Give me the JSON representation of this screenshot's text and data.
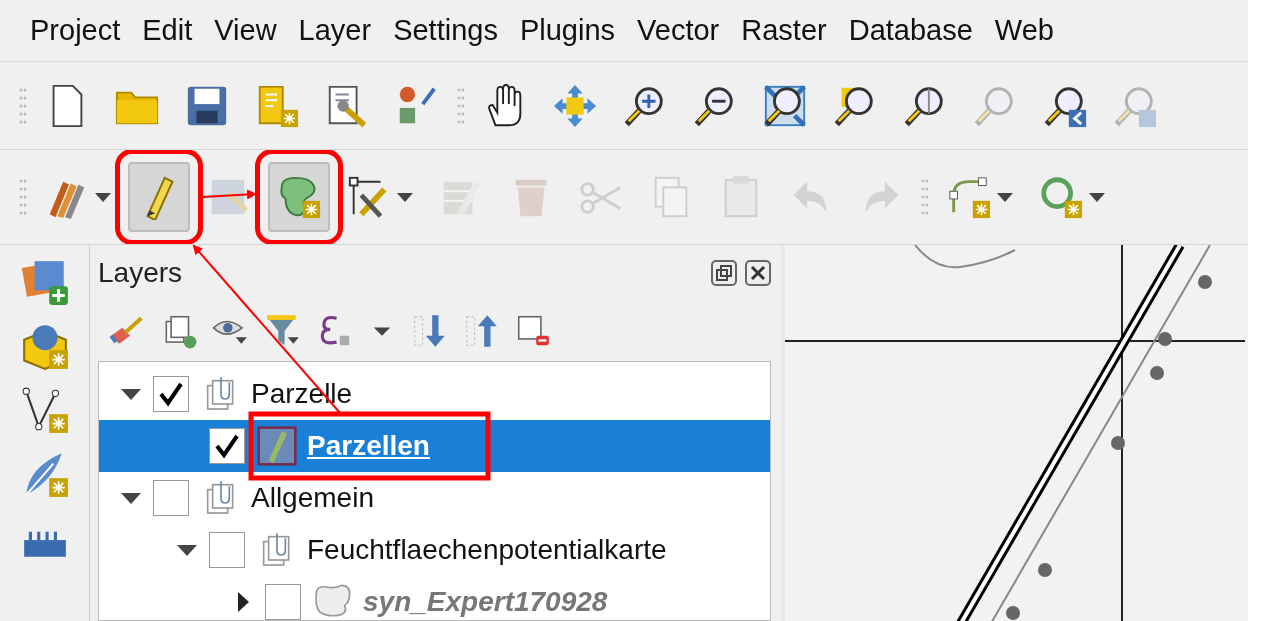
{
  "menu_bar": [
    {
      "label": "Project"
    },
    {
      "label": "Edit"
    },
    {
      "label": "View"
    },
    {
      "label": "Layer"
    },
    {
      "label": "Settings"
    },
    {
      "label": "Plugins"
    },
    {
      "label": "Vector"
    },
    {
      "label": "Raster"
    },
    {
      "label": "Database"
    },
    {
      "label": "Web"
    }
  ],
  "toolbar_1": [
    {
      "kind": "grip",
      "disabled": false,
      "pressed": false,
      "dropdown": false,
      "annotated": false
    },
    {
      "kind": "new-page",
      "disabled": false,
      "pressed": false,
      "dropdown": false,
      "annotated": false
    },
    {
      "kind": "folder",
      "disabled": false,
      "pressed": false,
      "dropdown": false,
      "annotated": false
    },
    {
      "kind": "floppy",
      "disabled": false,
      "pressed": false,
      "dropdown": false,
      "annotated": false
    },
    {
      "kind": "layout-doc",
      "disabled": false,
      "pressed": false,
      "dropdown": false,
      "annotated": false
    },
    {
      "kind": "wrench-doc",
      "disabled": false,
      "pressed": false,
      "dropdown": false,
      "annotated": false
    },
    {
      "kind": "shapes",
      "disabled": false,
      "pressed": false,
      "dropdown": false,
      "annotated": false
    },
    {
      "kind": "grip",
      "disabled": false,
      "pressed": false,
      "dropdown": false,
      "annotated": false
    },
    {
      "kind": "hand",
      "disabled": false,
      "pressed": false,
      "dropdown": false,
      "annotated": false
    },
    {
      "kind": "move-arrows",
      "disabled": false,
      "pressed": false,
      "dropdown": false,
      "annotated": false
    },
    {
      "kind": "zoom-in",
      "disabled": false,
      "pressed": false,
      "dropdown": false,
      "annotated": false
    },
    {
      "kind": "zoom-out",
      "disabled": false,
      "pressed": false,
      "dropdown": false,
      "annotated": false
    },
    {
      "kind": "zoom-full",
      "disabled": false,
      "pressed": false,
      "dropdown": false,
      "annotated": false
    },
    {
      "kind": "zoom-selection",
      "disabled": false,
      "pressed": false,
      "dropdown": false,
      "annotated": false
    },
    {
      "kind": "zoom-layer",
      "disabled": false,
      "pressed": false,
      "dropdown": false,
      "annotated": false
    },
    {
      "kind": "zoom-native",
      "disabled": true,
      "pressed": false,
      "dropdown": false,
      "annotated": false
    },
    {
      "kind": "zoom-last",
      "disabled": false,
      "pressed": false,
      "dropdown": false,
      "annotated": false
    },
    {
      "kind": "zoom-next",
      "disabled": true,
      "pressed": false,
      "dropdown": false,
      "annotated": false
    }
  ],
  "toolbar_2": [
    {
      "kind": "grip",
      "disabled": false,
      "pressed": false,
      "dropdown": false,
      "annotated": false
    },
    {
      "kind": "pencils",
      "disabled": false,
      "pressed": false,
      "dropdown": true,
      "annotated": false
    },
    {
      "kind": "pencil",
      "disabled": false,
      "pressed": true,
      "dropdown": false,
      "annotated": true
    },
    {
      "kind": "save-edits",
      "disabled": true,
      "pressed": false,
      "dropdown": false,
      "annotated": false
    },
    {
      "kind": "add-polygon",
      "disabled": false,
      "pressed": true,
      "dropdown": false,
      "annotated": true
    },
    {
      "kind": "vertex-tool",
      "disabled": false,
      "pressed": false,
      "dropdown": true,
      "annotated": false
    },
    {
      "kind": "edit-table",
      "disabled": true,
      "pressed": false,
      "dropdown": false,
      "annotated": false
    },
    {
      "kind": "trash",
      "disabled": true,
      "pressed": false,
      "dropdown": false,
      "annotated": false
    },
    {
      "kind": "scissors",
      "disabled": true,
      "pressed": false,
      "dropdown": false,
      "annotated": false
    },
    {
      "kind": "copy",
      "disabled": true,
      "pressed": false,
      "dropdown": false,
      "annotated": false
    },
    {
      "kind": "paste",
      "disabled": true,
      "pressed": false,
      "dropdown": false,
      "annotated": false
    },
    {
      "kind": "undo",
      "disabled": true,
      "pressed": false,
      "dropdown": false,
      "annotated": false
    },
    {
      "kind": "redo",
      "disabled": true,
      "pressed": false,
      "dropdown": false,
      "annotated": false
    },
    {
      "kind": "grip",
      "disabled": false,
      "pressed": false,
      "dropdown": false,
      "annotated": false
    },
    {
      "kind": "curve",
      "disabled": false,
      "pressed": false,
      "dropdown": true,
      "annotated": false
    },
    {
      "kind": "circle",
      "disabled": false,
      "pressed": false,
      "dropdown": true,
      "annotated": false
    }
  ],
  "annotation_arrows": true,
  "side_toolbar": [
    {
      "kind": "add-layers"
    },
    {
      "kind": "globe-cube"
    },
    {
      "kind": "vertex-v"
    },
    {
      "kind": "feather"
    },
    {
      "kind": "ruler"
    }
  ],
  "layers_panel": {
    "title": "Layers",
    "tools": [
      {
        "kind": "brush"
      },
      {
        "kind": "add-group"
      },
      {
        "kind": "eye-menu"
      },
      {
        "kind": "filter-menu"
      },
      {
        "kind": "epsilon"
      },
      {
        "kind": "caret"
      },
      {
        "kind": "expand-all"
      },
      {
        "kind": "collapse-all"
      },
      {
        "kind": "remove"
      }
    ],
    "tree": [
      {
        "label": "Parzelle",
        "kind": "group",
        "expandable": true,
        "expanded": true,
        "checked": true,
        "selected": false,
        "out_of_scale": false,
        "annotated": false,
        "children": [
          {
            "label": "Parzellen",
            "kind": "layer-editing",
            "expandable": false,
            "checked": true,
            "selected": true,
            "out_of_scale": false,
            "annotated": true
          }
        ]
      },
      {
        "label": "Allgemein",
        "kind": "group",
        "expandable": true,
        "expanded": true,
        "checked": false,
        "selected": false,
        "out_of_scale": false,
        "annotated": false,
        "children": [
          {
            "label": "Feuchtflaechenpotentialkarte",
            "kind": "group",
            "expandable": true,
            "expanded": true,
            "checked": false,
            "selected": false,
            "out_of_scale": false,
            "annotated": false,
            "children": [
              {
                "label": "syn_Expert170928",
                "kind": "layer-polygon",
                "expandable": true,
                "expanded": false,
                "checked": false,
                "selected": false,
                "out_of_scale": true,
                "annotated": false
              }
            ]
          }
        ]
      }
    ]
  }
}
